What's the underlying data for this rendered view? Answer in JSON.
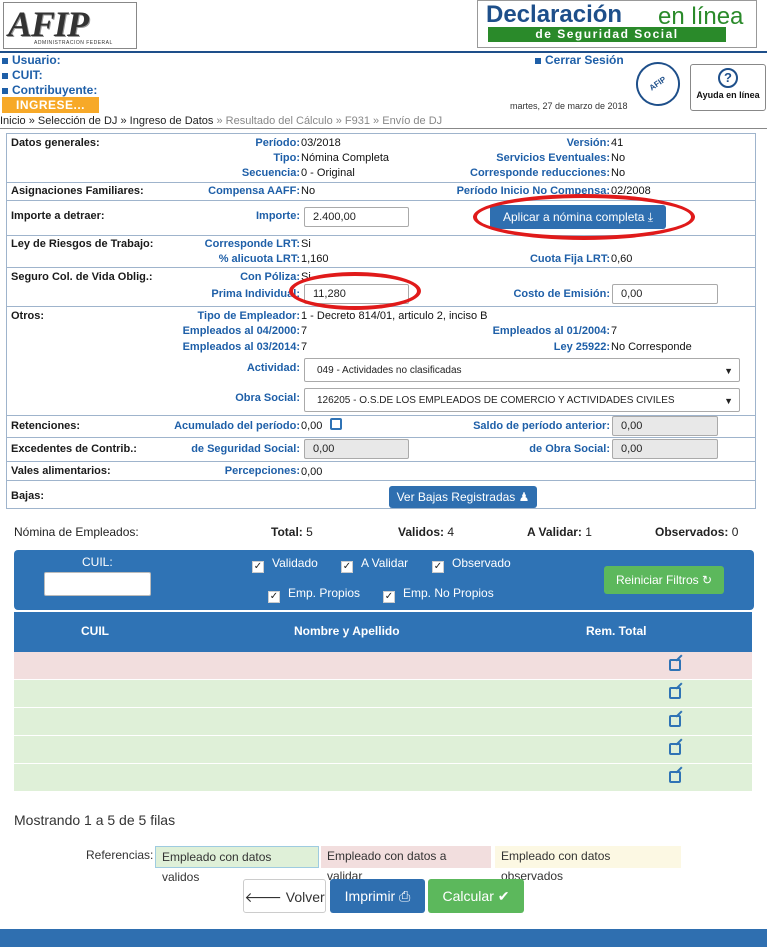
{
  "header": {
    "afip_logo": "AFIP",
    "afip_sub": "ADMINISTRACION FEDERAL",
    "dj_title_a": "Declaración",
    "dj_title_b": "en línea",
    "dj_sub": "de Seguridad Social",
    "usuario": "Usuario:",
    "cuit": "CUIT:",
    "contribuyente": "Contribuyente:",
    "ingrese": "INGRESE...",
    "cerrar": "Cerrar Sesión",
    "date": "martes, 27 de marzo de 2018",
    "seal": "AFIP",
    "help": "Ayuda en línea"
  },
  "breadcrumb": {
    "items": [
      "Inicio",
      "Selección de DJ",
      "Ingreso de Datos",
      "Resultado del Cálculo",
      "F931",
      "Envío de DJ"
    ],
    "sep": " » "
  },
  "datos": {
    "section": "Datos generales:",
    "periodo_l": "Período:",
    "periodo_v": "03/2018",
    "tipo_l": "Tipo:",
    "tipo_v": "Nómina Completa",
    "secuencia_l": "Secuencia:",
    "secuencia_v": "0 - Original",
    "version_l": "Versión:",
    "version_v": "41",
    "serv_l": "Servicios Eventuales:",
    "serv_v": "No",
    "red_l": "Corresponde reducciones:",
    "red_v": "No"
  },
  "asig": {
    "section": "Asignaciones Familiares:",
    "comp_l": "Compensa AAFF:",
    "comp_v": "No",
    "inicio_l": "Período Inicio No Compensa:",
    "inicio_v": "02/2008"
  },
  "importe": {
    "section": "Importe a detraer:",
    "imp_l": "Importe:",
    "imp_v": "2.400,00",
    "btn": "Aplicar a nómina completa"
  },
  "lrt": {
    "section": "Ley de Riesgos de Trabajo:",
    "corr_l": "Corresponde LRT:",
    "corr_v": "Si",
    "alic_l": "% alicuota LRT:",
    "alic_v": "1,160",
    "cuota_l": "Cuota Fija LRT:",
    "cuota_v": "0,60"
  },
  "seguro": {
    "section": "Seguro Col. de Vida Oblig.:",
    "poliza_l": "Con Póliza:",
    "poliza_v": "Si",
    "prima_l": "Prima Individual:",
    "prima_v": "11,280",
    "costo_l": "Costo de Emisión:",
    "costo_v": "0,00"
  },
  "otros": {
    "section": "Otros:",
    "tipo_l": "Tipo de Empleador:",
    "tipo_v": "1 - Decreto 814/01, articulo 2, inciso B",
    "e2000_l": "Empleados al 04/2000:",
    "e2000_v": "7",
    "e2004_l": "Empleados al 01/2004:",
    "e2004_v": "7",
    "e2014_l": "Empleados al 03/2014:",
    "e2014_v": "7",
    "ley_l": "Ley 25922:",
    "ley_v": "No Corresponde",
    "act_l": "Actividad:",
    "act_v": "049 - Actividades no clasificadas",
    "os_l": "Obra Social:",
    "os_v": "126205 - O.S.DE LOS EMPLEADOS DE COMERCIO Y ACTIVIDADES CIVILES"
  },
  "ret": {
    "section": "Retenciones:",
    "acum_l": "Acumulado del período:",
    "acum_v": "0,00",
    "saldo_l": "Saldo de período anterior:",
    "saldo_v": "0,00"
  },
  "exc": {
    "section": "Excedentes de Contrib.:",
    "ss_l": "de Seguridad Social:",
    "ss_v": "0,00",
    "os_l": "de Obra Social:",
    "os_v": "0,00"
  },
  "vales": {
    "section": "Vales alimentarios:",
    "perc_l": "Percepciones:",
    "perc_v": "0,00"
  },
  "bajas": {
    "section": "Bajas:",
    "btn": "Ver Bajas Registradas"
  },
  "summary": {
    "nomina": "Nómina de Empleados:",
    "total_l": "Total:",
    "total_v": "5",
    "validos_l": "Validos:",
    "validos_v": "4",
    "avalidar_l": "A Validar:",
    "avalidar_v": "1",
    "obs_l": "Observados:",
    "obs_v": "0"
  },
  "filters": {
    "cuil_l": "CUIL:",
    "validado": "Validado",
    "avalidar": "A Validar",
    "observado": "Observado",
    "propios": "Emp. Propios",
    "nopropios": "Emp. No Propios",
    "reset": "Reiniciar Filtros"
  },
  "table": {
    "col1": "CUIL",
    "col2": "Nombre y Apellido",
    "col3": "Rem. Total",
    "rows": [
      {
        "status": "a validar"
      },
      {
        "status": "valido"
      },
      {
        "status": "valido"
      },
      {
        "status": "valido"
      },
      {
        "status": "valido"
      }
    ]
  },
  "showing": "Mostrando 1 a 5 de 5 filas",
  "refs": {
    "label": "Referencias:",
    "r1": "Empleado con datos validos",
    "r2": "Empleado con datos a validar",
    "r3": "Empleado con datos observados"
  },
  "buttons": {
    "volver": "Volver",
    "imprimir": "Imprimir",
    "calcular": "Calcular"
  },
  "colors": {
    "blue": "#2f73b5",
    "green": "#5cb85c",
    "pink": "#f2dede",
    "lightgreen": "#dff0d8",
    "highlight": "#e01a1a"
  }
}
